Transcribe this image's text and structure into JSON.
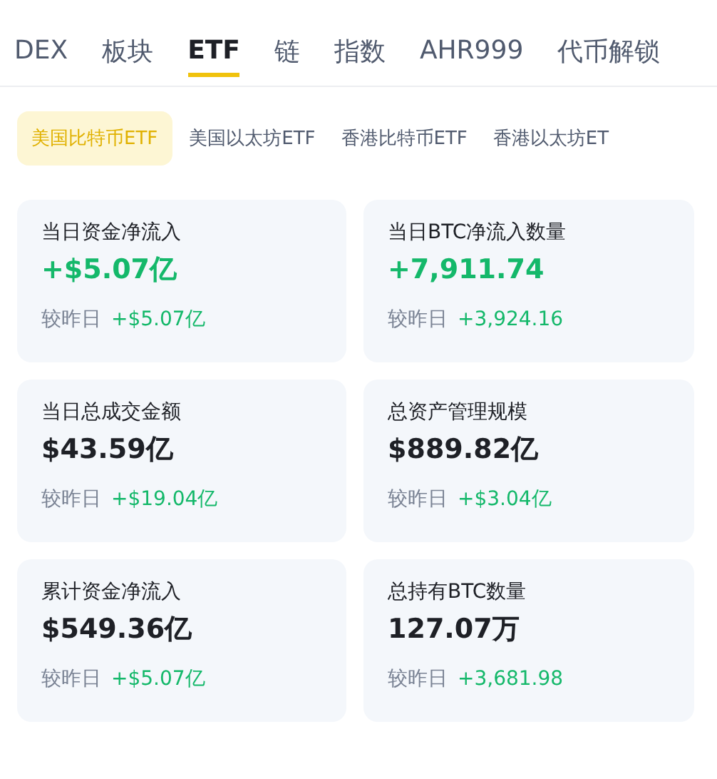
{
  "tabs": [
    {
      "label": "DEX",
      "selected": false
    },
    {
      "label": "板块",
      "selected": false
    },
    {
      "label": "ETF",
      "selected": true
    },
    {
      "label": "链",
      "selected": false
    },
    {
      "label": "指数",
      "selected": false
    },
    {
      "label": "AHR999",
      "selected": false
    },
    {
      "label": "代币解锁",
      "selected": false
    }
  ],
  "sub_tabs": [
    {
      "label": "美国比特币ETF",
      "selected": true
    },
    {
      "label": "美国以太坊ETF",
      "selected": false
    },
    {
      "label": "香港比特币ETF",
      "selected": false
    },
    {
      "label": "香港以太坊ET",
      "selected": false
    }
  ],
  "cards": [
    {
      "title": "当日资金净流入",
      "value": "+$5.07亿",
      "color": "#14b86a",
      "compare_label": "较昨日",
      "compare_value": "+$5.07亿"
    },
    {
      "title": "当日BTC净流入数量",
      "value": "+7,911.74",
      "color": "#14b86a",
      "compare_label": "较昨日",
      "compare_value": "+3,924.16"
    },
    {
      "title": "当日总成交金额",
      "value": "$43.59亿",
      "color": "#1e2026",
      "compare_label": "较昨日",
      "compare_value": "+$19.04亿"
    },
    {
      "title": "总资产管理规模",
      "value": "$889.82亿",
      "color": "#1e2026",
      "compare_label": "较昨日",
      "compare_value": "+$3.04亿"
    },
    {
      "title": "累计资金净流入",
      "value": "$549.36亿",
      "color": "#1e2026",
      "compare_label": "较昨日",
      "compare_value": "+$5.07亿"
    },
    {
      "title": "总持有BTC数量",
      "value": "127.07万",
      "color": "#1e2026",
      "compare_label": "较昨日",
      "compare_value": "+3,681.98"
    }
  ]
}
